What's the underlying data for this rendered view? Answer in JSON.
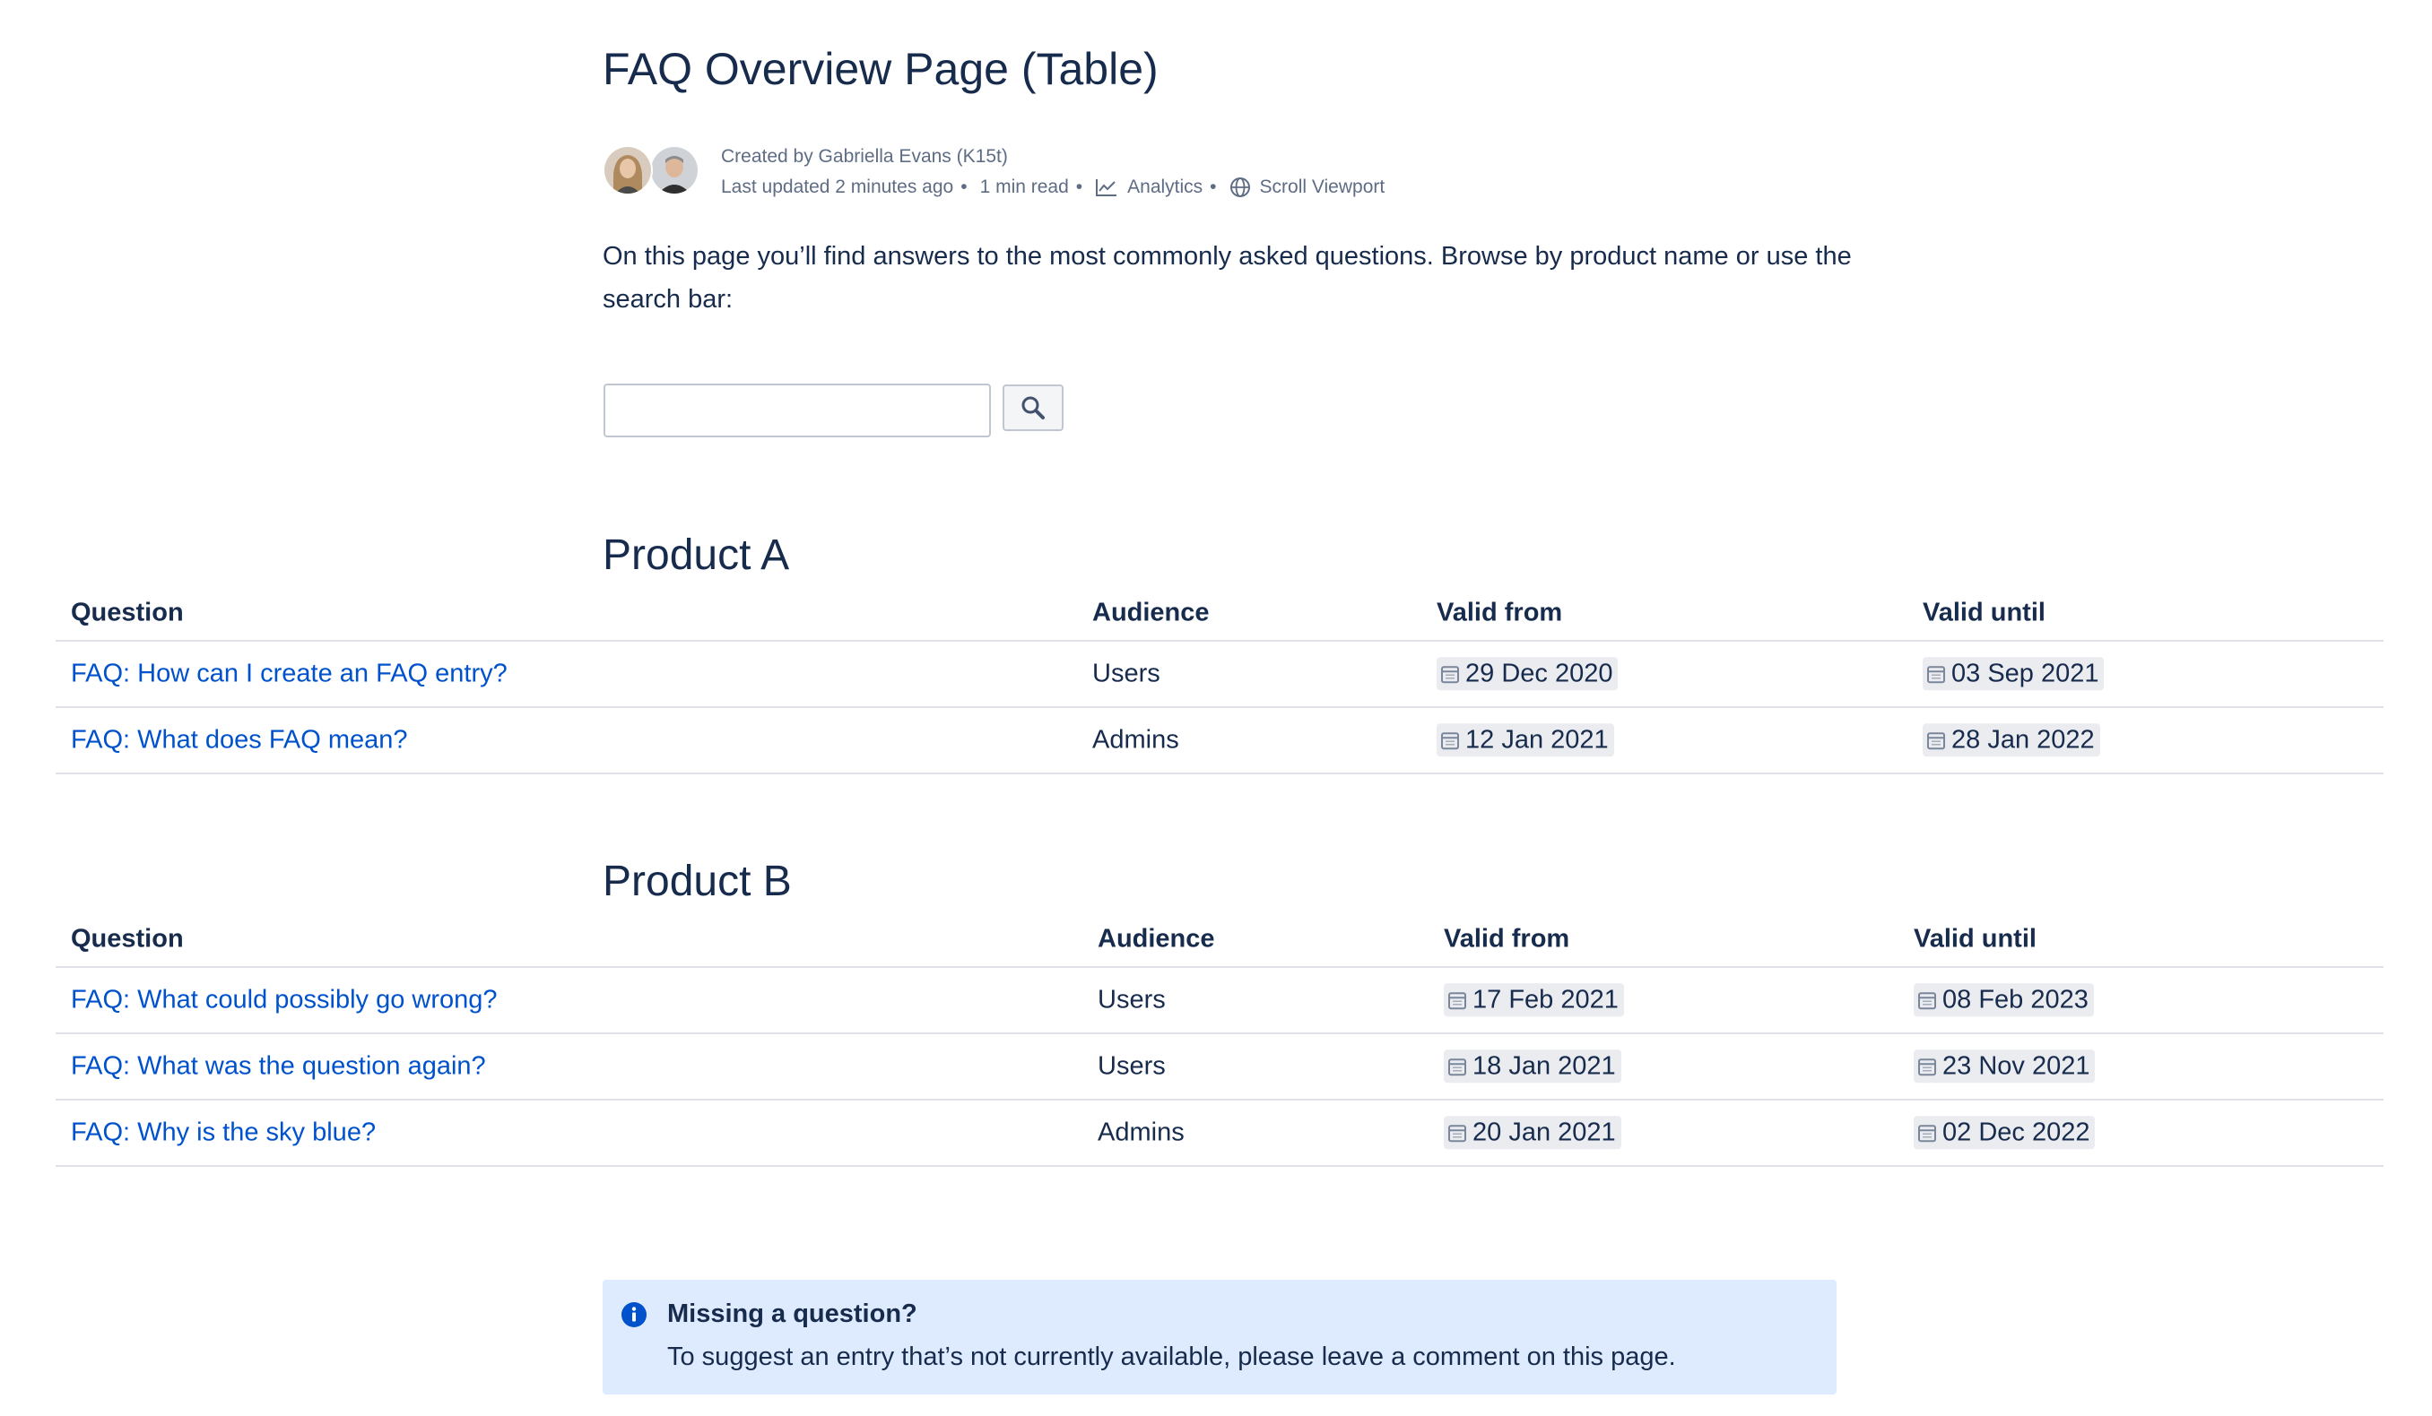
{
  "page": {
    "title": "FAQ Overview Page (Table)"
  },
  "byline": {
    "created_by": "Created by Gabriella Evans (K15t)",
    "last_updated": "Last updated 2 minutes ago",
    "read_time": "1 min read",
    "analytics_label": "Analytics",
    "scroll_viewport_label": "Scroll Viewport",
    "separator": "•"
  },
  "intro": {
    "text": "On this page you’ll find answers to the most commonly asked questions. Browse by product name or use the search bar:"
  },
  "search": {
    "value": "",
    "placeholder": ""
  },
  "sections": [
    {
      "heading": "Product A",
      "columns": [
        "Question",
        "Audience",
        "Valid from",
        "Valid until"
      ],
      "rows": [
        {
          "question": "FAQ: How can I create an FAQ entry?",
          "audience": "Users",
          "valid_from": "29 Dec 2020",
          "valid_until": "03 Sep 2021"
        },
        {
          "question": "FAQ: What does FAQ mean?",
          "audience": "Admins",
          "valid_from": "12 Jan 2021",
          "valid_until": "28 Jan 2022"
        }
      ]
    },
    {
      "heading": "Product B",
      "columns": [
        "Question",
        "Audience",
        "Valid from",
        "Valid until"
      ],
      "rows": [
        {
          "question": "FAQ: What could possibly go wrong?",
          "audience": "Users",
          "valid_from": "17 Feb 2021",
          "valid_until": "08 Feb 2023"
        },
        {
          "question": "FAQ: What was the question again?",
          "audience": "Users",
          "valid_from": "18 Jan 2021",
          "valid_until": "23 Nov 2021"
        },
        {
          "question": "FAQ: Why is the sky blue?",
          "audience": "Admins",
          "valid_from": "20 Jan 2021",
          "valid_until": "02 Dec 2022"
        }
      ]
    }
  ],
  "info_panel": {
    "title": "Missing a question?",
    "body": "To suggest an entry that’s not currently available, please leave a comment on this page."
  },
  "colors": {
    "text": "#172b4d",
    "link": "#0052cc",
    "muted": "#5e6c84",
    "info_background": "#deebff",
    "info_icon": "#0052cc",
    "divider": "#dfe1e6",
    "date_lozenge": "#ebecf0"
  },
  "icons": {
    "search_button": "search-icon",
    "analytics": "chart-line-icon",
    "scroll_viewport": "globe-icon",
    "date": "calendar-icon",
    "info_panel": "info-icon"
  }
}
